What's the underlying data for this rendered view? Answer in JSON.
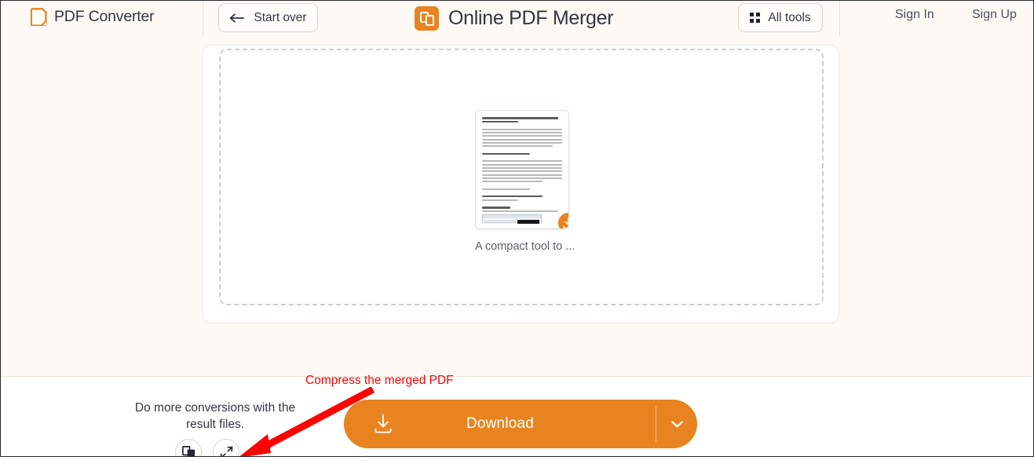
{
  "header": {
    "brand": "PDF Converter",
    "brand_icon": "pdf-document-icon",
    "start_over": "Start over",
    "start_over_icon": "arrow-left-icon",
    "tool_title": "Online PDF Merger",
    "tool_title_icon": "merge-pages-icon",
    "all_tools": "All tools",
    "all_tools_icon": "grid-dots-icon",
    "sign_in": "Sign In",
    "sign_up": "Sign Up"
  },
  "main": {
    "file": {
      "name": "A compact tool to ...",
      "download_icon": "download-icon"
    }
  },
  "footer": {
    "more_conversions": "Do more conversions with the result files.",
    "actions": [
      {
        "icon": "copy-duplicate-icon",
        "name": "copy"
      },
      {
        "icon": "compress-arrows-icon",
        "name": "compress"
      }
    ],
    "download_label": "Download",
    "download_icon": "download-icon",
    "download_caret_icon": "chevron-down-icon"
  },
  "annotation": {
    "text": "Compress the merged PDF",
    "color": "#fe0000"
  },
  "colors": {
    "accent": "#e8841f",
    "page_bg": "#fdfaf5",
    "card_bg": "#ffffff",
    "text": "#323640",
    "annotation": "#fe0000"
  }
}
